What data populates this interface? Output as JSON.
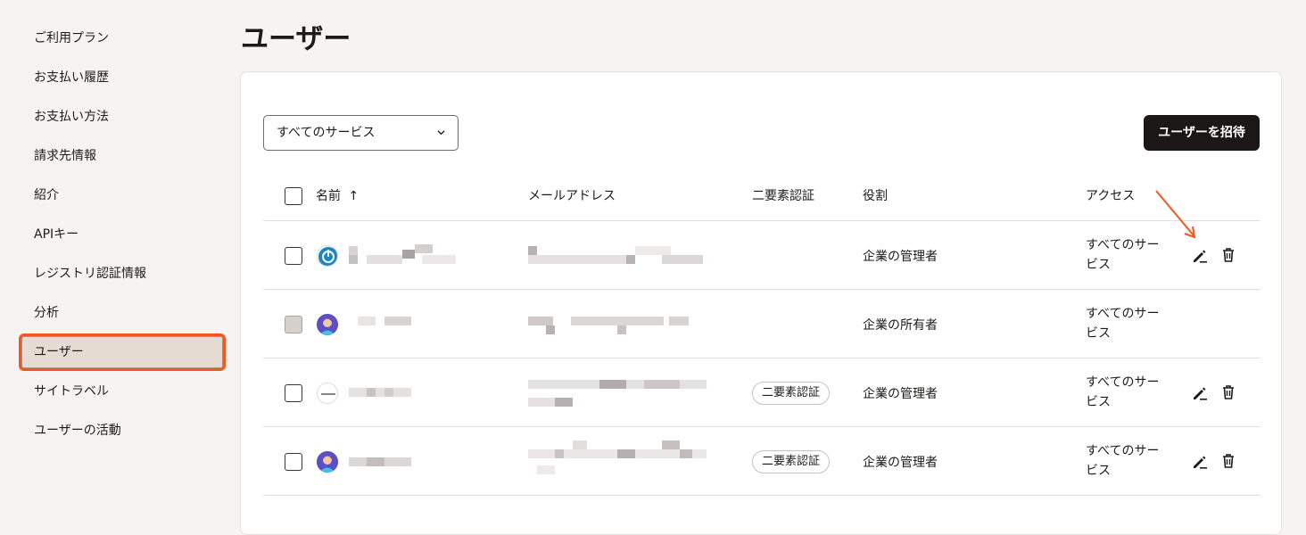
{
  "sidebar": {
    "items": [
      {
        "label": "ご利用プラン"
      },
      {
        "label": "お支払い履歴"
      },
      {
        "label": "お支払い方法"
      },
      {
        "label": "請求先情報"
      },
      {
        "label": "紹介"
      },
      {
        "label": "APIキー"
      },
      {
        "label": "レジストリ認証情報"
      },
      {
        "label": "分析"
      },
      {
        "label": "ユーザー"
      },
      {
        "label": "サイトラベル"
      },
      {
        "label": "ユーザーの活動"
      }
    ],
    "active_index": 8
  },
  "page": {
    "title": "ユーザー"
  },
  "toolbar": {
    "service_filter": "すべてのサービス",
    "invite_label": "ユーザーを招待"
  },
  "table": {
    "headers": {
      "name": "名前",
      "sort_indicator": "↑",
      "email": "メールアドレス",
      "two_factor": "二要素認証",
      "role": "役割",
      "access": "アクセス"
    },
    "rows": [
      {
        "two_factor": "",
        "role": "企業の管理者",
        "access": "すべてのサービス",
        "editable": true
      },
      {
        "two_factor": "",
        "role": "企業の所有者",
        "access": "すべてのサービス",
        "editable": false
      },
      {
        "two_factor": "二要素認証",
        "role": "企業の管理者",
        "access": "すべてのサービス",
        "editable": true
      },
      {
        "two_factor": "二要素認証",
        "role": "企業の管理者",
        "access": "すべてのサービス",
        "editable": true
      }
    ]
  },
  "colors": {
    "accent_highlight": "#f2581e",
    "primary_button": "#1b1717",
    "background": "#f7f3f0"
  },
  "icons": {
    "edit": "pencil-icon",
    "delete": "trash-icon",
    "dropdown": "chevron-down-icon"
  }
}
